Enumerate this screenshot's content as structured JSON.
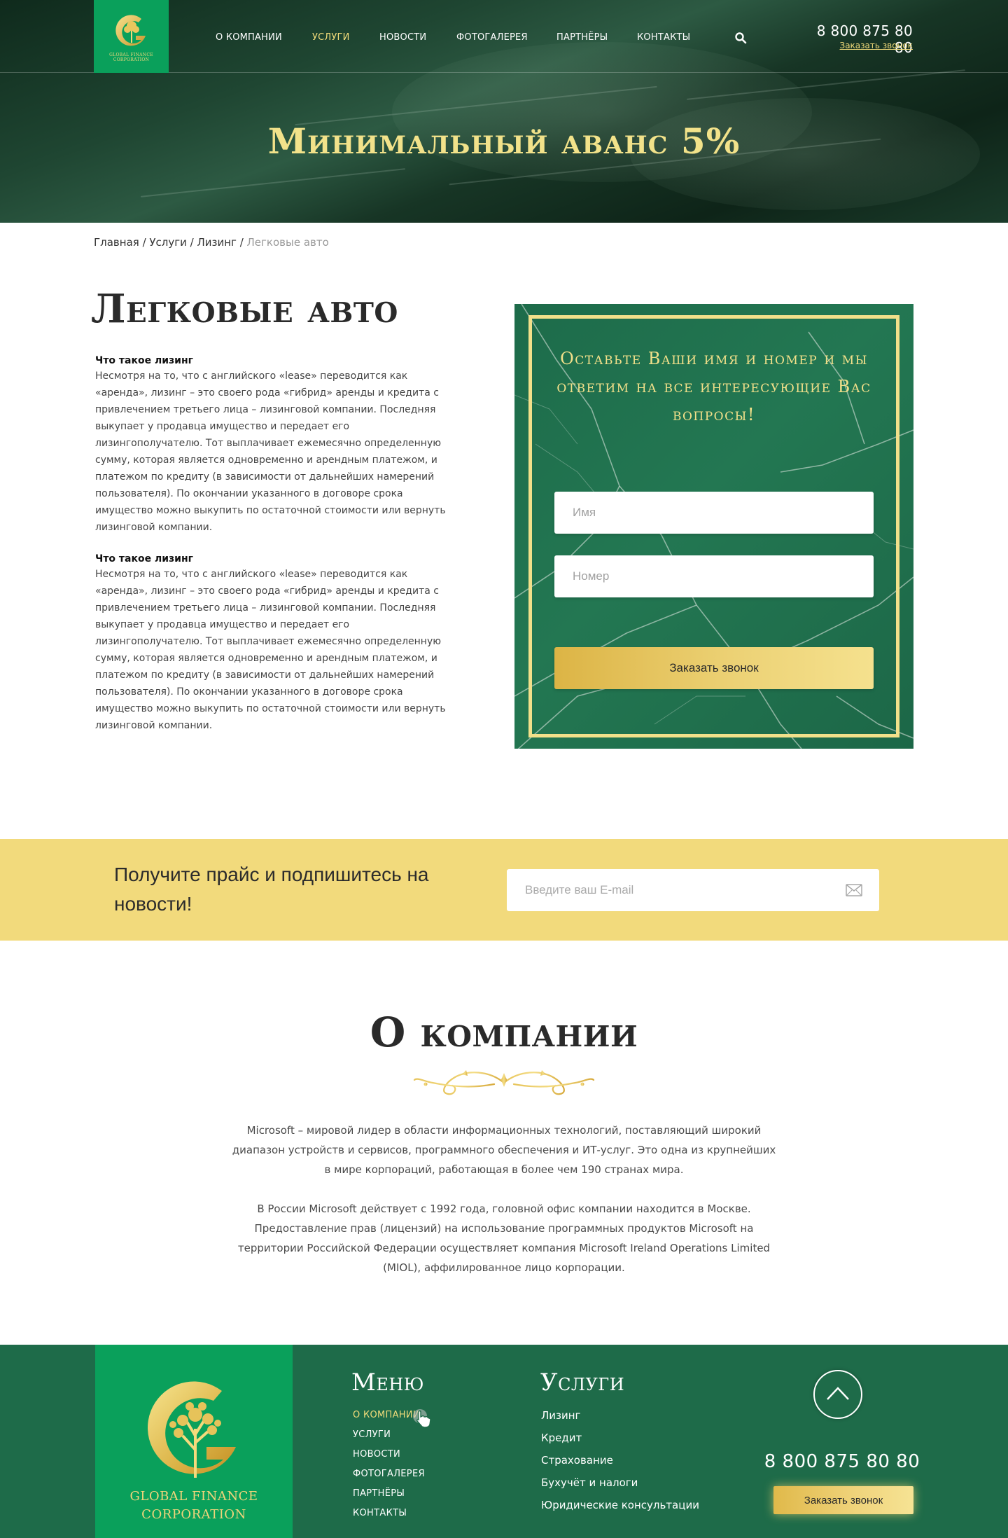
{
  "header": {
    "logo_text_line1": "GLOBAL FINANCE",
    "logo_text_line2": "CORPORATION",
    "nav": [
      {
        "label": "О КОМПАНИИ"
      },
      {
        "label": "УСЛУГИ"
      },
      {
        "label": "НОВОСТИ"
      },
      {
        "label": "ФОТОГАЛЕРЕЯ"
      },
      {
        "label": "ПАРТНЁРЫ"
      },
      {
        "label": "КОНТАКТЫ"
      }
    ],
    "active_nav": "УСЛУГИ",
    "phone": "8 800 875 80 80",
    "callback_link": "Заказать звонок",
    "search_icon": "search-icon"
  },
  "hero": {
    "title": "Минимальный аванс 5%"
  },
  "breadcrumb": {
    "items": [
      "Главная",
      "Услуги",
      "Лизинг"
    ],
    "current": "Легковые авто"
  },
  "main": {
    "title": "Легковые авто",
    "sections": [
      {
        "heading": "Что такое лизинг",
        "text": "Несмотря на то, что с английского «lease» переводится как «аренда», лизинг – это своего рода «гибрид» аренды и кредита с привлечением третьего лица – лизинговой компании. Последняя выкупает у продавца имущество и передает его лизингополучателю. Тот выплачивает ежемесячно определенную сумму, которая является одновременно и арендным платежом, и платежом по кредиту (в зависимости от дальнейших намерений пользователя). По окончании указанного в договоре срока имущество можно выкупить по остаточной стоимости или вернуть лизинговой компании."
      },
      {
        "heading": "Что такое лизинг",
        "text": "Несмотря на то, что с английского «lease» переводится как «аренда», лизинг – это своего рода «гибрид» аренды и кредита с привлечением третьего лица – лизинговой компании. Последняя выкупает у продавца имущество и передает его лизингополучателю. Тот выплачивает ежемесячно определенную сумму, которая является одновременно и арендным платежом, и платежом по кредиту (в зависимости от дальнейших намерений пользователя). По окончании указанного в договоре срока имущество можно выкупить по остаточной стоимости или вернуть лизинговой компании."
      }
    ]
  },
  "form": {
    "heading": "Оставьте Ваши имя и номер и мы ответим на все интересующие Вас вопросы!",
    "name_placeholder": "Имя",
    "name_value": "",
    "phone_placeholder": "Номер",
    "phone_value": "",
    "submit_label": "Заказать звонок"
  },
  "subscribe": {
    "text": "Получите прайс и подпишитесь на новости!",
    "email_placeholder": "Введите ваш E-mail",
    "email_value": "",
    "icon": "mail-icon"
  },
  "about": {
    "title": "О компании",
    "paragraph1": "Microsoft – мировой лидер в области информационных технологий, поставляющий широкий диапазон устройств и сервисов, программного обеспечения и ИТ-услуг. Это одна из крупнейших в мире корпораций, работающая в более чем 190 странах мира.",
    "paragraph2": "В России Microsoft действует с 1992 года, головной офис компании находится в Москве. Предоставление прав (лицензий) на использование программных продуктов Microsoft на территории Российской Федерации осуществляет компания Microsoft Ireland Operations Limited (MIOL), аффилированное лицо корпорации."
  },
  "footer": {
    "logo_text_line1": "GLOBAL FINANCE",
    "logo_text_line2": "CORPORATION",
    "menu_title": "Меню",
    "menu": [
      "О КОМПАНИИ",
      "УСЛУГИ",
      "НОВОСТИ",
      "ФОТОГАЛЕРЕЯ",
      "ПАРТНЁРЫ",
      "КОНТАКТЫ"
    ],
    "services_title": "Услуги",
    "services": [
      "Лизинг",
      "Кредит",
      "Страхование",
      "Бухучёт и налоги",
      "Юридические консультации"
    ],
    "phone": "8 800 875 80 80",
    "callback_button": "Заказать звонок",
    "scroll_top_icon": "chevron-up-icon"
  },
  "colors": {
    "brand_green": "#1e6b49",
    "logo_green": "#0aa05b",
    "gold": "#f2da7c",
    "active_nav": "#f2dc7a"
  }
}
